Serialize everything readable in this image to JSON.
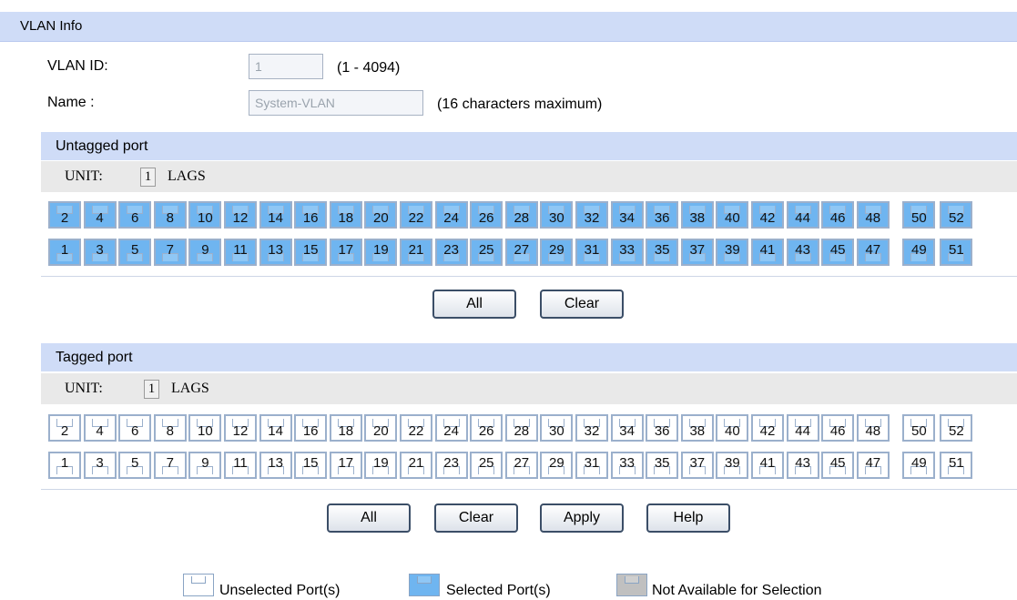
{
  "header": {
    "title": "VLAN Info"
  },
  "vlan_id": {
    "label": "VLAN ID:",
    "value": "1",
    "hint": "(1 - 4094)"
  },
  "name": {
    "label": "Name :",
    "value": "System-VLAN",
    "hint": "(16 characters maximum)"
  },
  "untagged": {
    "title": "Untagged port",
    "unit_label": "UNIT:",
    "unit_value": "1",
    "lags_label": "LAGS",
    "state": "selected",
    "buttons": {
      "all": "All",
      "clear": "Clear"
    }
  },
  "tagged": {
    "title": "Tagged port",
    "unit_label": "UNIT:",
    "unit_value": "1",
    "lags_label": "LAGS",
    "state": "unselected",
    "buttons": {
      "all": "All",
      "clear": "Clear",
      "apply": "Apply",
      "help": "Help"
    }
  },
  "ports": {
    "top_row": [
      "2",
      "4",
      "6",
      "8",
      "10",
      "12",
      "14",
      "16",
      "18",
      "20",
      "22",
      "24",
      "26",
      "28",
      "30",
      "32",
      "34",
      "36",
      "38",
      "40",
      "42",
      "44",
      "46",
      "48",
      "50",
      "52"
    ],
    "bottom_row": [
      "1",
      "3",
      "5",
      "7",
      "9",
      "11",
      "13",
      "15",
      "17",
      "19",
      "21",
      "23",
      "25",
      "27",
      "29",
      "31",
      "33",
      "35",
      "37",
      "39",
      "41",
      "43",
      "45",
      "47",
      "49",
      "51"
    ]
  },
  "legend": {
    "unselected": "Unselected Port(s)",
    "selected": "Selected Port(s)",
    "unavailable": "Not Available for Selection"
  },
  "colors": {
    "selected": "#6fb5f0",
    "unselected": "#ffffff",
    "unavailable": "#c0c0c0",
    "header_bg": "#cfdcf7"
  }
}
